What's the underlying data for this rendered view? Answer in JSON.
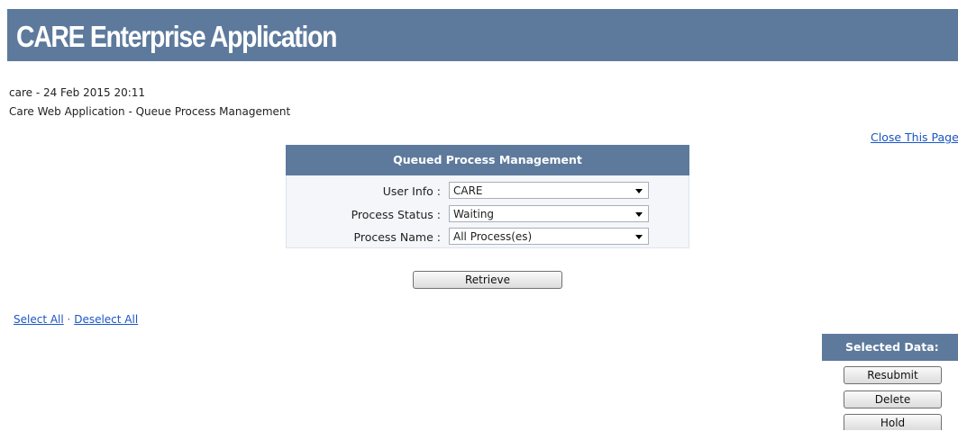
{
  "header": {
    "title": "CARE Enterprise Application"
  },
  "info": {
    "user_timestamp": "care - 24 Feb 2015 20:11",
    "app_subtitle": "Care Web Application - Queue Process Management"
  },
  "close_link": "Close This Page",
  "panel": {
    "title": "Queued Process Management",
    "fields": [
      {
        "label": "User Info :",
        "value": "CARE"
      },
      {
        "label": "Process Status :",
        "value": "Waiting"
      },
      {
        "label": "Process Name :",
        "value": "All Process(es)"
      }
    ],
    "retrieve_label": "Retrieve"
  },
  "selection": {
    "select_all": "Select All",
    "separator": "·",
    "deselect_all": "Deselect All"
  },
  "selected_data": {
    "title": "Selected Data:",
    "actions": [
      "Resubmit",
      "Delete",
      "Hold"
    ]
  },
  "colors": {
    "header_bg": "#5d7a9c",
    "link": "#1a55c4",
    "panel_bg": "#f4f6fa"
  }
}
